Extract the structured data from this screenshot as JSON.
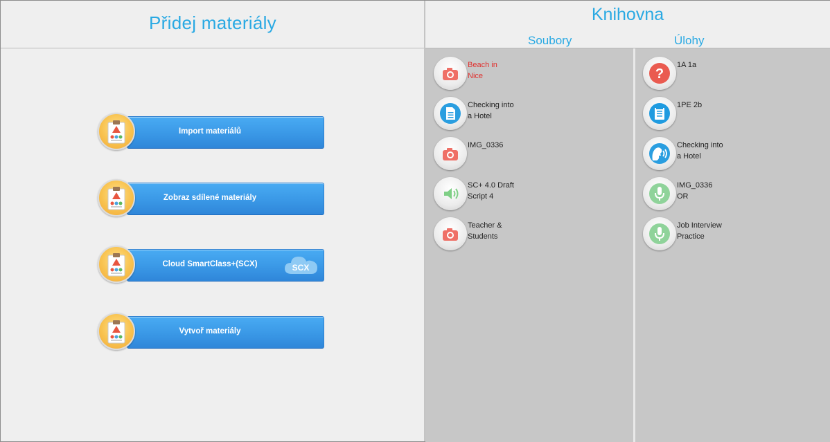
{
  "left": {
    "title": "Přidej materiály",
    "actions": [
      {
        "label": "Import materiálů",
        "icon": "materials-icon"
      },
      {
        "label": "Zobraz sdílené materiály",
        "icon": "materials-icon"
      },
      {
        "label": "Cloud SmartClass+(SCX)",
        "icon": "materials-icon",
        "badge": "SCX"
      },
      {
        "label": "Vytvoř materiály",
        "icon": "materials-icon"
      }
    ]
  },
  "library": {
    "title": "Knihovna",
    "files_heading": "Soubory",
    "tasks_heading": "Úlohy",
    "files": [
      {
        "line1": "Beach in",
        "line2": "Nice",
        "icon": "camera-icon",
        "highlight": true
      },
      {
        "line1": "Checking into",
        "line2": "a Hotel",
        "icon": "document-icon"
      },
      {
        "line1": "IMG_0336",
        "line2": "",
        "icon": "camera-icon"
      },
      {
        "line1": "SC+ 4.0 Draft",
        "line2": "Script 4",
        "icon": "audio-icon"
      },
      {
        "line1": "Teacher &",
        "line2": "Students",
        "icon": "camera-icon"
      }
    ],
    "tasks": [
      {
        "line1": "1A 1a",
        "line2": "",
        "icon": "question-icon"
      },
      {
        "line1": "1PE 2b",
        "line2": "",
        "icon": "reading-icon"
      },
      {
        "line1": "Checking into",
        "line2": "a Hotel",
        "icon": "speaking-icon"
      },
      {
        "line1": "IMG_0336",
        "line2": "OR",
        "icon": "microphone-icon"
      },
      {
        "line1": "Job Interview",
        "line2": "Practice",
        "icon": "microphone-icon"
      }
    ]
  },
  "colors": {
    "accent": "#29a9e3",
    "button": "#3a98e6",
    "panel": "#c7c7c7",
    "highlight_text": "#e0302e"
  }
}
